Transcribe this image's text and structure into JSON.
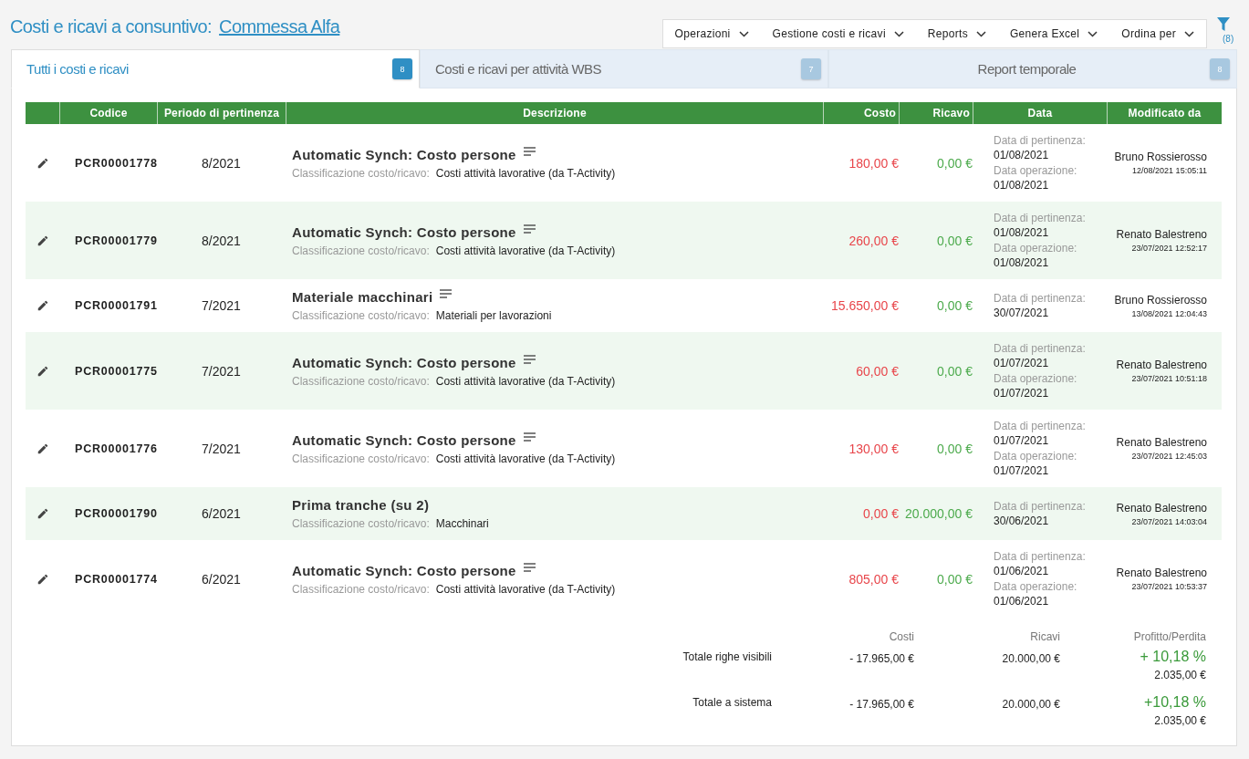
{
  "title": {
    "text": "Costi e ricavi a consuntivo:",
    "link": "Commessa Alfa"
  },
  "toolbar": [
    "Operazioni",
    "Gestione costi e ricavi",
    "Reports",
    "Genera Excel",
    "Ordina per"
  ],
  "filter": {
    "count": "(8)"
  },
  "tabs": [
    {
      "label": "Tutti i costi e ricavi",
      "count": "8",
      "selected": true
    },
    {
      "label": "Costi e ricavi per attività WBS",
      "count": "7",
      "selected": false
    },
    {
      "label": "Report temporale",
      "count": "8",
      "selected": false
    }
  ],
  "table": {
    "columns": [
      "Codice",
      "Periodo di pertinenza",
      "Descrizione",
      "Costo",
      "Ricavo",
      "Data",
      "Modificato da"
    ],
    "rows": [
      {
        "code": "PCR00001778",
        "period": "8/2021",
        "title": "Automatic Synch: Costo persone",
        "notes": true,
        "class_label": "Classificazione costo/ricavo:",
        "class_value": "Costi attività lavorative (da T-Activity)",
        "cost": "180,00 €",
        "revenue": "0,00 €",
        "dates": [
          {
            "label": "Data di pertinenza:",
            "value": "01/08/2021"
          },
          {
            "label": "Data operazione:",
            "value": "01/08/2021"
          }
        ],
        "user": "Bruno Rossierosso",
        "modified": "12/08/2021 15:05:11"
      },
      {
        "code": "PCR00001779",
        "period": "8/2021",
        "title": "Automatic Synch: Costo persone",
        "notes": true,
        "class_label": "Classificazione costo/ricavo:",
        "class_value": "Costi attività lavorative (da T-Activity)",
        "cost": "260,00 €",
        "revenue": "0,00 €",
        "dates": [
          {
            "label": "Data di pertinenza:",
            "value": "01/08/2021"
          },
          {
            "label": "Data operazione:",
            "value": "01/08/2021"
          }
        ],
        "user": "Renato Balestreno",
        "modified": "23/07/2021 12:52:17"
      },
      {
        "code": "PCR00001791",
        "period": "7/2021",
        "title": "Materiale macchinari",
        "notes": true,
        "class_label": "Classificazione costo/ricavo:",
        "class_value": "Materiali per lavorazioni",
        "cost": "15.650,00 €",
        "revenue": "0,00 €",
        "dates": [
          {
            "label": "Data di pertinenza:",
            "value": "30/07/2021"
          }
        ],
        "user": "Bruno Rossierosso",
        "modified": "13/08/2021 12:04:43"
      },
      {
        "code": "PCR00001775",
        "period": "7/2021",
        "title": "Automatic Synch: Costo persone",
        "notes": true,
        "class_label": "Classificazione costo/ricavo:",
        "class_value": "Costi attività lavorative (da T-Activity)",
        "cost": "60,00 €",
        "revenue": "0,00 €",
        "dates": [
          {
            "label": "Data di pertinenza:",
            "value": "01/07/2021"
          },
          {
            "label": "Data operazione:",
            "value": "01/07/2021"
          }
        ],
        "user": "Renato Balestreno",
        "modified": "23/07/2021 10:51:18"
      },
      {
        "code": "PCR00001776",
        "period": "7/2021",
        "title": "Automatic Synch: Costo persone",
        "notes": true,
        "class_label": "Classificazione costo/ricavo:",
        "class_value": "Costi attività lavorative (da T-Activity)",
        "cost": "130,00 €",
        "revenue": "0,00 €",
        "dates": [
          {
            "label": "Data di pertinenza:",
            "value": "01/07/2021"
          },
          {
            "label": "Data operazione:",
            "value": "01/07/2021"
          }
        ],
        "user": "Renato Balestreno",
        "modified": "23/07/2021 12:45:03"
      },
      {
        "code": "PCR00001790",
        "period": "6/2021",
        "title": "Prima tranche (su 2)",
        "notes": false,
        "class_label": "Classificazione costo/ricavo:",
        "class_value": "Macchinari",
        "cost": "0,00 €",
        "revenue": "20.000,00 €",
        "dates": [
          {
            "label": "Data di pertinenza:",
            "value": "30/06/2021"
          }
        ],
        "user": "Renato Balestreno",
        "modified": "23/07/2021 14:03:04"
      },
      {
        "code": "PCR00001774",
        "period": "6/2021",
        "title": "Automatic Synch: Costo persone",
        "notes": true,
        "class_label": "Classificazione costo/ricavo:",
        "class_value": "Costi attività lavorative (da T-Activity)",
        "cost": "805,00 €",
        "revenue": "0,00 €",
        "dates": [
          {
            "label": "Data di pertinenza:",
            "value": "01/06/2021"
          },
          {
            "label": "Data operazione:",
            "value": "01/06/2021"
          }
        ],
        "user": "Renato Balestreno",
        "modified": "23/07/2021 10:53:37"
      }
    ]
  },
  "totals": {
    "columns": [
      "Costi",
      "Ricavi",
      "Profitto/Perdita"
    ],
    "rows": [
      {
        "label": "Totale righe visibili",
        "costs": "- 17.965,00 €",
        "revenues": "20.000,00 €",
        "percent": "+ 10,18 %",
        "profit": "2.035,00 €"
      },
      {
        "label": "Totale a sistema",
        "costs": "- 17.965,00 €",
        "revenues": "20.000,00 €",
        "percent": "+10,18 %",
        "profit": "2.035,00 €"
      }
    ]
  }
}
